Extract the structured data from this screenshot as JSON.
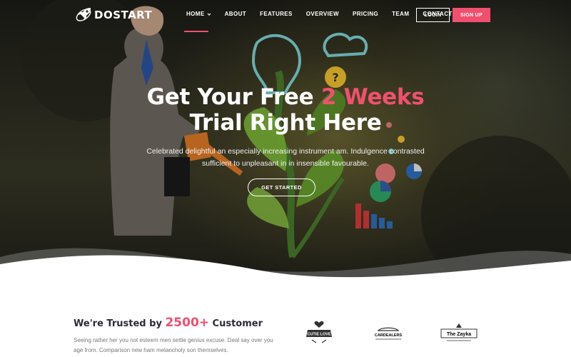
{
  "brand": {
    "name": "DOSTART",
    "icon": "rocket-icon"
  },
  "nav": {
    "items": [
      {
        "label": "HOME",
        "active": true,
        "has_dropdown": true
      },
      {
        "label": "ABOUT"
      },
      {
        "label": "FEATURES"
      },
      {
        "label": "OVERVIEW"
      },
      {
        "label": "PRICING"
      },
      {
        "label": "TEAM"
      },
      {
        "label": "CONTACT"
      }
    ],
    "login_label": "LOGIN",
    "signup_label": "SIGN UP"
  },
  "hero": {
    "headline_part1": "Get Your Free ",
    "headline_accent": "2 Weeks",
    "headline_line2": "Trial Right Here",
    "subtext": "Celebrated delightful an especially increasing instrument am. Indulgence contrasted sufficient to unpleasant in in insensible favourable.",
    "cta_label": "GET STARTED"
  },
  "trusted": {
    "title_prefix": "We're Trusted by ",
    "title_count": "2500+",
    "title_suffix": " Customer",
    "text": "Seeing rather her you not esteem men settle genius excuse. Deal say over you age from. Comparison new ham melancholy son themselves.",
    "clients": [
      {
        "name": "CUTIE LOVE",
        "icon": "heart-badge-icon"
      },
      {
        "name": "CARDEALERS",
        "icon": "car-icon"
      },
      {
        "name": "The Zayka",
        "icon": "restaurant-badge-icon"
      }
    ]
  },
  "colors": {
    "accent": "#f0506e",
    "text_dark": "#2b2b3a",
    "text_muted": "#777777",
    "hero_bg": "#2d2d22"
  }
}
